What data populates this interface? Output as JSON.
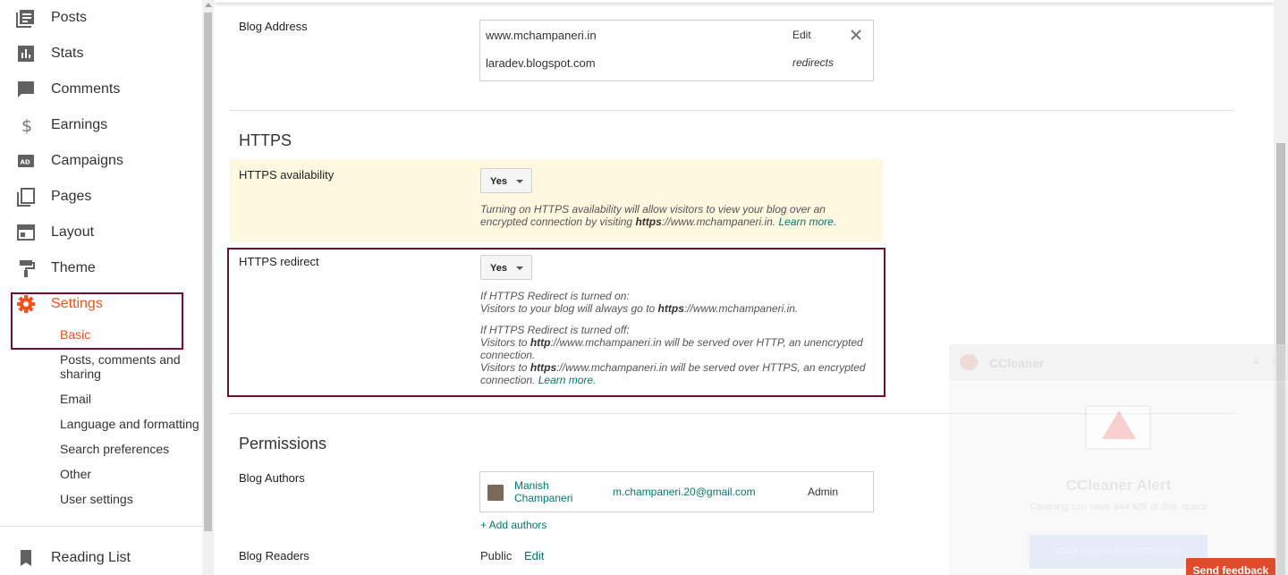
{
  "sidebar": {
    "items": [
      {
        "label": "Posts",
        "icon": "posts-icon"
      },
      {
        "label": "Stats",
        "icon": "stats-icon"
      },
      {
        "label": "Comments",
        "icon": "comments-icon"
      },
      {
        "label": "Earnings",
        "icon": "dollar-icon"
      },
      {
        "label": "Campaigns",
        "icon": "campaigns-icon"
      },
      {
        "label": "Pages",
        "icon": "pages-icon"
      },
      {
        "label": "Layout",
        "icon": "layout-icon"
      },
      {
        "label": "Theme",
        "icon": "theme-icon"
      },
      {
        "label": "Settings",
        "icon": "gear-icon"
      }
    ],
    "settings_sub": [
      "Basic",
      "Posts, comments and sharing",
      "Email",
      "Language and formatting",
      "Search preferences",
      "Other",
      "User settings"
    ],
    "reading_list": "Reading List",
    "active_color": "#f4511e"
  },
  "blog_address": {
    "label": "Blog Address",
    "domain": "www.mchampaneri.in",
    "edit": "Edit",
    "blogspot": "laradev.blogspot.com",
    "redirects": "redirects"
  },
  "https": {
    "title": "HTTPS",
    "availability_label": "HTTPS availability",
    "availability_value": "Yes",
    "availability_help_1": "Turning on HTTPS availability will allow visitors to view your blog over an",
    "availability_help_2a": "encrypted connection by visiting ",
    "availability_help_2b": "https",
    "availability_help_2c": "://www.mchampaneri.in. ",
    "learn_more": "Learn more.",
    "redirect_label": "HTTPS redirect",
    "redirect_value": "Yes",
    "on_title": "If HTTPS Redirect is turned on:",
    "on_line_a": "Visitors to your blog will always go to ",
    "on_line_b": "https",
    "on_line_c": "://www.mchampaneri.in.",
    "off_title": "If HTTPS Redirect is turned off:",
    "off_1a": "Visitors to ",
    "off_1b": "http",
    "off_1c": "://www.mchampaneri.in will be served over HTTP, an unencrypted",
    "off_1d": "connection.",
    "off_2a": "Visitors to ",
    "off_2b": "https",
    "off_2c": "://www.mchampaneri.in will be served over HTTPS, an encrypted",
    "off_2d": "connection. "
  },
  "permissions": {
    "title": "Permissions",
    "authors_label": "Blog Authors",
    "author_name_1": "Manish",
    "author_name_2": "Champaneri",
    "author_email": "m.champaneri.20@gmail.com",
    "author_role": "Admin",
    "add_authors": "+ Add authors",
    "readers_label": "Blog Readers",
    "readers_value": "Public",
    "readers_edit": "Edit"
  },
  "ccleaner": {
    "title": "CCleaner",
    "alert": "CCleaner Alert",
    "sub": "Cleaning can save 644 MB of disk space",
    "button": "Click here to open CCleaner"
  },
  "feedback": "Send feedback"
}
